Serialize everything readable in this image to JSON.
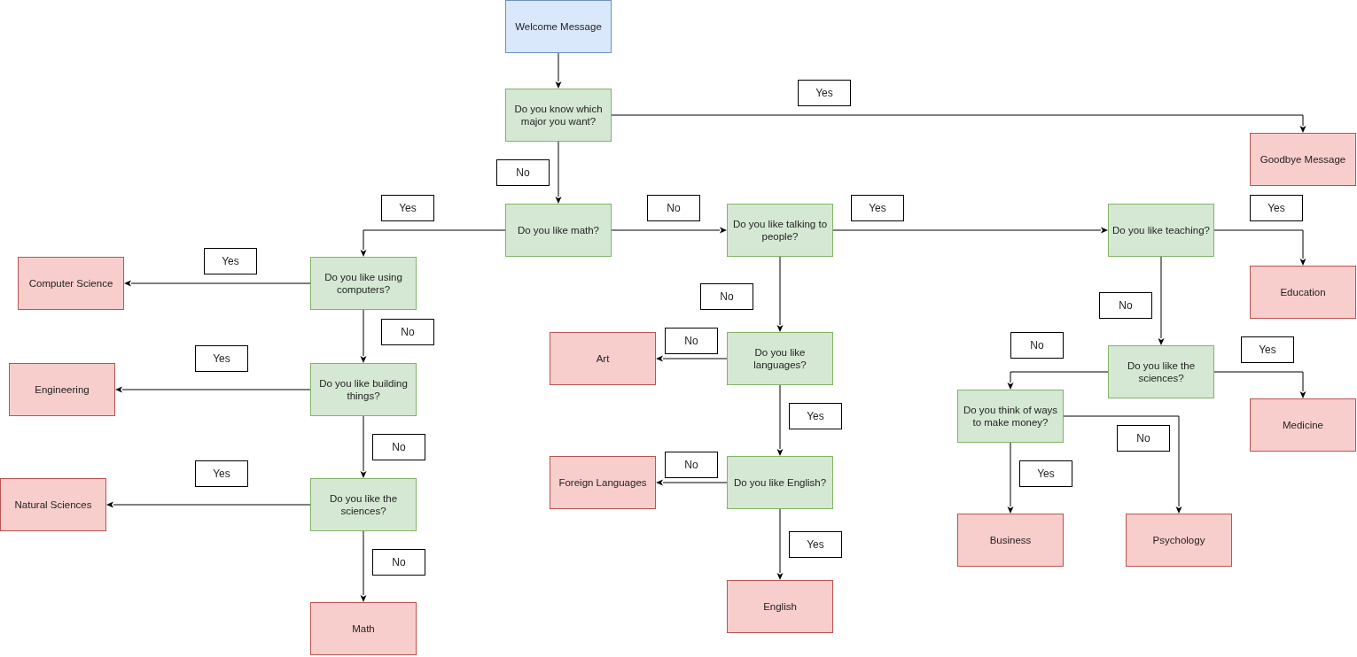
{
  "nodes": [
    {
      "kind": "start",
      "text": "Welcome Message"
    },
    {
      "kind": "question",
      "text": "Do you know which major you want?"
    },
    {
      "kind": "outcome",
      "text": "Goodbye Message"
    },
    {
      "kind": "question",
      "text": "Do you like math?"
    },
    {
      "kind": "question",
      "text": "Do you like talking to people?"
    },
    {
      "kind": "question",
      "text": "Do you like teaching?"
    },
    {
      "kind": "outcome",
      "text": "Computer Science"
    },
    {
      "kind": "question",
      "text": "Do you like using computers?"
    },
    {
      "kind": "outcome",
      "text": "Education"
    },
    {
      "kind": "outcome",
      "text": "Art"
    },
    {
      "kind": "question",
      "text": "Do you like languages?"
    },
    {
      "kind": "question",
      "text": "Do you like the sciences?"
    },
    {
      "kind": "outcome",
      "text": "Engineering"
    },
    {
      "kind": "question",
      "text": "Do you like building things?"
    },
    {
      "kind": "question",
      "text": "Do you think of ways to make money?"
    },
    {
      "kind": "outcome",
      "text": "Medicine"
    },
    {
      "kind": "outcome",
      "text": "Foreign Languages"
    },
    {
      "kind": "question",
      "text": "Do you like English?"
    },
    {
      "kind": "outcome",
      "text": "Natural Sciences"
    },
    {
      "kind": "question",
      "text": "Do you like the sciences?"
    },
    {
      "kind": "outcome",
      "text": "Business"
    },
    {
      "kind": "outcome",
      "text": "Psychology"
    },
    {
      "kind": "outcome",
      "text": "English"
    },
    {
      "kind": "outcome",
      "text": "Math"
    }
  ],
  "labels": [
    "Yes",
    "No",
    "Yes",
    "No",
    "Yes",
    "Yes",
    "Yes",
    "No",
    "No",
    "No",
    "No",
    "No",
    "Yes",
    "Yes",
    "Yes",
    "No",
    "No",
    "No",
    "Yes",
    "Yes",
    "Yes",
    "No"
  ]
}
